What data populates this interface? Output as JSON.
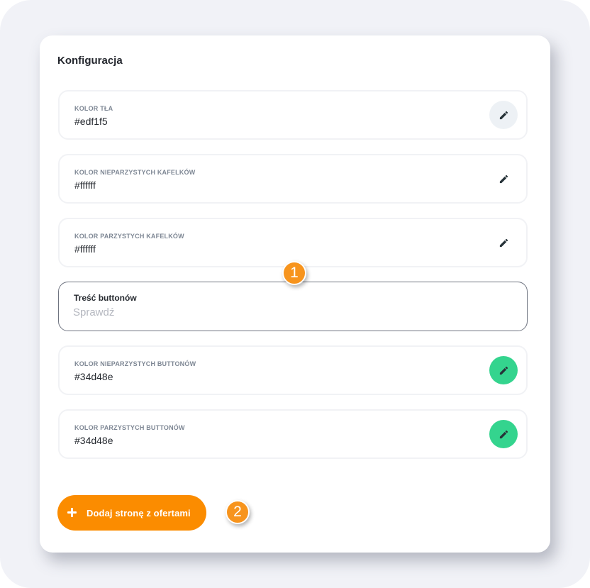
{
  "colors": {
    "accent_green": "#34d48e",
    "edit_idle_bg": "#edf1f5",
    "orange": "#fb8c00",
    "icon_dark": "#263238"
  },
  "card": {
    "title": "Konfiguracja"
  },
  "fields": [
    {
      "label": "Kolor tła",
      "value": "#edf1f5",
      "button_icon": "pencil-icon",
      "button_bg": "#edf1f5"
    },
    {
      "label": "Kolor nieparzystych kafelków",
      "value": "#ffffff",
      "button_icon": "pencil-icon",
      "button_bg": "#ffffff"
    },
    {
      "label": "Kolor parzystych kafelków",
      "value": "#ffffff",
      "button_icon": "pencil-icon",
      "button_bg": "#ffffff"
    }
  ],
  "button_text_field": {
    "label": "Treść buttonów",
    "placeholder": "Sprawdź",
    "value": ""
  },
  "button_fields": [
    {
      "label": "Kolor nieparzystych buttonów",
      "value": "#34d48e",
      "button_icon": "pencil-icon",
      "button_bg": "#34d48e"
    },
    {
      "label": "Kolor parzystych buttonów",
      "value": "#34d48e",
      "button_icon": "pencil-icon",
      "button_bg": "#34d48e"
    }
  ],
  "add_button": {
    "label": "Dodaj stronę z ofertami",
    "icon": "plus-icon"
  },
  "markers": [
    {
      "number": "1"
    },
    {
      "number": "2"
    }
  ]
}
